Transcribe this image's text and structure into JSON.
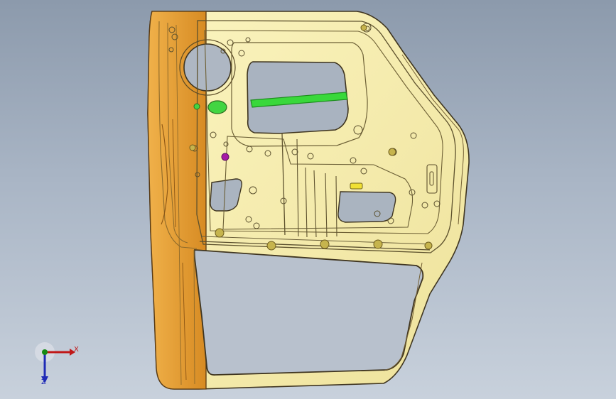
{
  "window": {
    "background_top": "#8c9aac",
    "background_bottom": "#c8d1dc"
  },
  "model": {
    "name": "door-inner-panel",
    "colors": {
      "panel": "#f2e9a6",
      "panel_stroke": "#3f3520",
      "flange": "#e7a33a",
      "flange_dark": "#c27a1b",
      "beam": "#39d83b",
      "purple_marker": "#a61aa6",
      "green_marker": "#42d542",
      "fastener": "#c6b44d"
    }
  },
  "triad": {
    "x_label": "X",
    "y_label": "Y",
    "z_label": "Z",
    "x_color": "#c01818",
    "y_color": "#168a16",
    "z_color": "#1f2bb6"
  }
}
